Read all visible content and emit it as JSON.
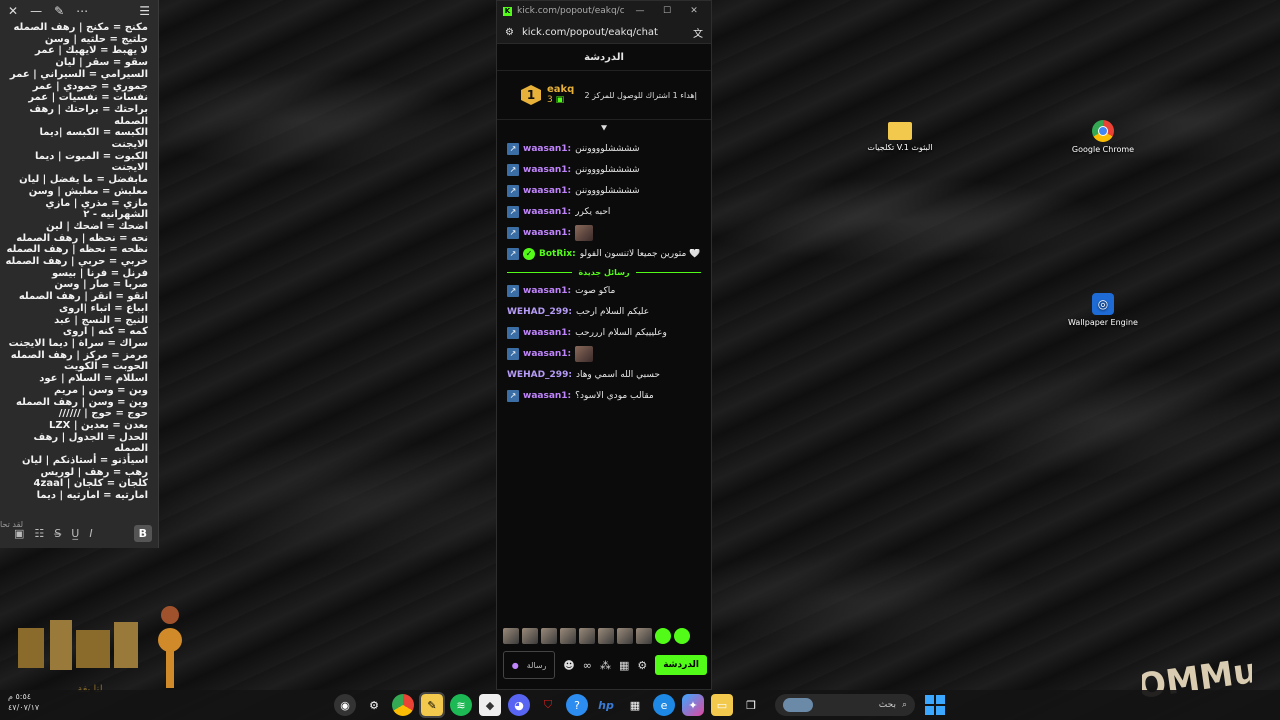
{
  "note": {
    "lines": [
      "مكنج = مكنج | رهف الصمله",
      "حلتيج = حلتيه | وسن",
      "لا يهبط = لايهبك | عمر",
      "سقو = سقر | ليان",
      "السيرامي = السيراني | عمر",
      "جموري = جمودي | عمر",
      "نفسات = نفسيات | عمر",
      "براحتك = براحتك | رهف الصمله",
      "الكبسه = الكبسه |ديما الايجنت",
      "الكبوت = الميوت | ديما الايجنت",
      "مابفضل = ما يفضل | ليان",
      "معلبش = معلبش | وسن",
      "مازي = مذري | مازي",
      "الشهرانيه - ٢",
      "اضحك = اضحك | لين",
      "نحه = نحظه | رهف الصمله",
      "نظحه = نحظه | رهف الصمله",
      "خربي = حربي | رهف الصمله",
      "فرنل = فرنا | بيسو",
      "صربا = صار | وسن",
      "انقو = انقر | رهف الصمله",
      "ابباع = اتباء |اروى",
      "النيج = النسج | عبد",
      "كمه = كنه | اروى",
      "سراك = سراة | ديما الايجنت",
      "مرمز = مركز | رهف الصمله",
      "الحوبت = الكويت",
      " اسللام = السلام | عود",
      "وبن = وسن | مريم",
      "وين = وسن | رهف الصمله",
      "حوج = حوج | //////",
      "بعدن = بعدين | LZX",
      "الحدل = الجدول | رهف الصمله",
      "اسيأذنو = أستاذنكم | ليان",
      "رهب = رهف | لوريس",
      "كلجان = كلجان | 4zaal",
      "امارتيه = امارتيه | ديما"
    ],
    "side_text": "لقد تحا"
  },
  "kick": {
    "tab_title": "kick.com/popout/eakq/chat...",
    "url": "kick.com/popout/eakq/chat",
    "header": "الدردشة",
    "pinned": {
      "badge": "1",
      "user": "eakq",
      "count": "3",
      "text": "إهداء 1 اشتراك للوصول للمركز 2"
    },
    "messages_before": [
      {
        "user": "waasan1:",
        "color": "#c084fc",
        "text": "ششششلووووننن"
      },
      {
        "user": "waasan1:",
        "color": "#c084fc",
        "text": "ششششلووووننن"
      },
      {
        "user": "waasan1:",
        "color": "#c084fc",
        "text": "ششششلووووننن"
      },
      {
        "user": "waasan1:",
        "color": "#c084fc",
        "text": "احبه يكرر"
      },
      {
        "user": "waasan1:",
        "color": "#c084fc",
        "text": ""
      },
      {
        "user": "BotRix:",
        "color": "#53fc18",
        "text": "متورين جميعاً لاتنسون الفولو 🤍"
      }
    ],
    "separator": "رسائل جديدة",
    "messages_after": [
      {
        "user": "waasan1:",
        "color": "#c084fc",
        "text": "ماكو صوت"
      },
      {
        "user": "WEHAD_299:",
        "color": "#b69cf7",
        "text": "عليكم السلام ارحب"
      },
      {
        "user": "waasan1:",
        "color": "#c084fc",
        "text": "وعليييكم السلام ارررحب"
      },
      {
        "user": "waasan1:",
        "color": "#c084fc",
        "text": ""
      },
      {
        "user": "WEHAD_299:",
        "color": "#b69cf7",
        "text": "حسبي الله اسمي وهاد"
      },
      {
        "user": "waasan1:",
        "color": "#c084fc",
        "text": "مقالب مودي الاسود؟"
      }
    ],
    "chat_button": "الدردشة",
    "input_placeholder": "رسالة"
  },
  "desktop_icons": [
    {
      "label": "تكلجيات V.1 البثوث",
      "icon": "folder-icon"
    },
    {
      "label": "Google Chrome",
      "icon": "chrome-icon"
    },
    {
      "label": "Wallpaper Engine",
      "icon": "wallpaper-engine-icon"
    }
  ],
  "taskbar": {
    "search_placeholder": "بحث",
    "clock_time": "٥:٥٤ م",
    "clock_date": "٤٧/٠٧/١٧"
  },
  "watermarks": {
    "left": "لنا بغة",
    "right": "COMMun"
  }
}
